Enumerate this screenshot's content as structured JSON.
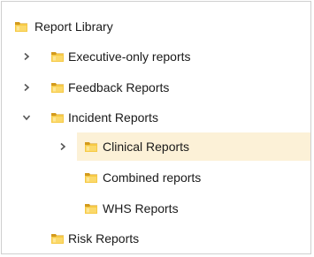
{
  "tree": {
    "root": {
      "label": "Report Library",
      "icon": "folder-icon"
    },
    "items": [
      {
        "label": "Executive-only reports",
        "icon": "folder-icon",
        "expander": "chevron-right-icon",
        "expanded": false
      },
      {
        "label": "Feedback Reports",
        "icon": "folder-icon",
        "expander": "chevron-right-icon",
        "expanded": false
      },
      {
        "label": "Incident Reports",
        "icon": "folder-icon",
        "expander": "chevron-down-icon",
        "expanded": true,
        "children": [
          {
            "label": "Clinical Reports",
            "icon": "folder-icon",
            "expander": "chevron-right-icon",
            "expanded": false,
            "selected": true
          },
          {
            "label": "Combined reports",
            "icon": "folder-icon"
          },
          {
            "label": "WHS Reports",
            "icon": "folder-icon"
          }
        ]
      },
      {
        "label": "Risk Reports",
        "icon": "folder-icon"
      }
    ]
  },
  "colors": {
    "selected_row": "#fcf1d7",
    "folder_yellow": "#f4c542",
    "folder_dark": "#d39a1c",
    "chevron": "#555555"
  }
}
